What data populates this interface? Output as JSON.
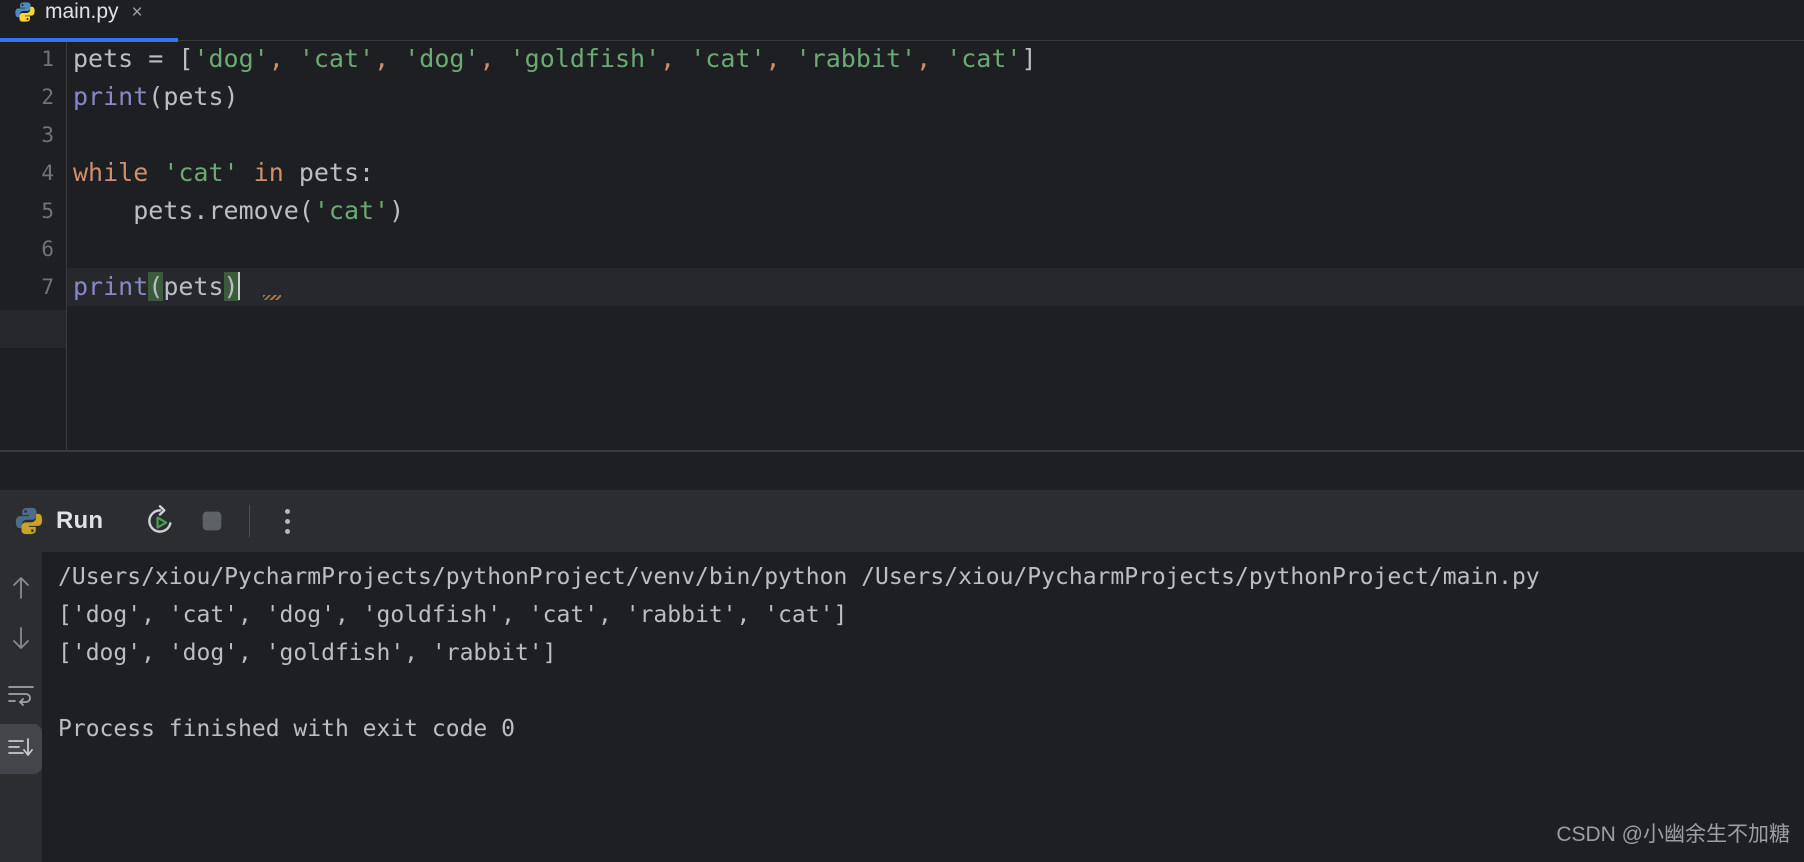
{
  "window": {
    "theme": "dark",
    "colors": {
      "editor_bg": "#1E1F22",
      "panel_bg": "#2B2D30",
      "tab_accent": "#3574F0",
      "keyword": "#CF8E6D",
      "string": "#6AAB73",
      "function": "#8888C6",
      "text": "#BCBEC4",
      "line_number": "#6F737A",
      "bracket_highlight": "#3A5C3D",
      "caret_row": "#26282E"
    }
  },
  "tabbar": {
    "tabs": [
      {
        "label": "main.py",
        "icon": "python-file-icon",
        "close_glyph": "×",
        "active": true
      }
    ]
  },
  "editor": {
    "line_numbers": [
      "1",
      "2",
      "3",
      "4",
      "5",
      "6",
      "7"
    ],
    "caret_line_index": 7,
    "lines": [
      {
        "number": "1",
        "plain": "pets = ['dog', 'cat', 'dog', 'goldfish', 'cat', 'rabbit', 'cat']",
        "tokens": [
          {
            "t": "pets ",
            "c": "ident"
          },
          {
            "t": "= ",
            "c": "punct"
          },
          {
            "t": "[",
            "c": "punct"
          },
          {
            "t": "'dog'",
            "c": "str"
          },
          {
            "t": ",",
            "c": "comma"
          },
          {
            "t": " ",
            "c": "punct"
          },
          {
            "t": "'cat'",
            "c": "str"
          },
          {
            "t": ",",
            "c": "comma"
          },
          {
            "t": " ",
            "c": "punct"
          },
          {
            "t": "'dog'",
            "c": "str"
          },
          {
            "t": ",",
            "c": "comma"
          },
          {
            "t": " ",
            "c": "punct"
          },
          {
            "t": "'goldfish'",
            "c": "str"
          },
          {
            "t": ",",
            "c": "comma"
          },
          {
            "t": " ",
            "c": "punct"
          },
          {
            "t": "'cat'",
            "c": "str"
          },
          {
            "t": ",",
            "c": "comma"
          },
          {
            "t": " ",
            "c": "punct"
          },
          {
            "t": "'rabbit'",
            "c": "str"
          },
          {
            "t": ",",
            "c": "comma"
          },
          {
            "t": " ",
            "c": "punct"
          },
          {
            "t": "'cat'",
            "c": "str"
          },
          {
            "t": "]",
            "c": "punct"
          }
        ]
      },
      {
        "number": "2",
        "plain": "print(pets)",
        "tokens": [
          {
            "t": "print",
            "c": "fn"
          },
          {
            "t": "(",
            "c": "punct"
          },
          {
            "t": "pets",
            "c": "ident"
          },
          {
            "t": ")",
            "c": "punct"
          }
        ]
      },
      {
        "number": "3",
        "plain": "",
        "tokens": []
      },
      {
        "number": "4",
        "plain": "while 'cat' in pets:",
        "tokens": [
          {
            "t": "while",
            "c": "kw"
          },
          {
            "t": " ",
            "c": "punct"
          },
          {
            "t": "'cat'",
            "c": "str"
          },
          {
            "t": " ",
            "c": "punct"
          },
          {
            "t": "in",
            "c": "kw"
          },
          {
            "t": " ",
            "c": "punct"
          },
          {
            "t": "pets",
            "c": "ident"
          },
          {
            "t": ":",
            "c": "punct"
          }
        ]
      },
      {
        "number": "5",
        "plain": "    pets.remove('cat')",
        "tokens": [
          {
            "t": "    pets.remove",
            "c": "ident"
          },
          {
            "t": "(",
            "c": "punct"
          },
          {
            "t": "'cat'",
            "c": "str"
          },
          {
            "t": ")",
            "c": "punct"
          }
        ]
      },
      {
        "number": "6",
        "plain": "",
        "tokens": []
      },
      {
        "number": "7",
        "plain": "print(pets)",
        "tokens": [
          {
            "t": "print",
            "c": "fn"
          },
          {
            "t": "(",
            "c": "brkhl"
          },
          {
            "t": "pets",
            "c": "ident"
          },
          {
            "t": ")",
            "c": "brkhl"
          }
        ]
      }
    ]
  },
  "run_panel": {
    "title": "Run",
    "icons": {
      "app": "python-icon",
      "rerun": "rerun-icon",
      "stop": "stop-icon",
      "more": "more-options-icon"
    },
    "gutter_icons": [
      {
        "name": "scroll-up-icon",
        "glyph": "↑"
      },
      {
        "name": "scroll-down-icon",
        "glyph": "↓"
      },
      {
        "name": "soft-wrap-icon",
        "glyph": "↩"
      },
      {
        "name": "scroll-to-end-icon",
        "glyph": "↓",
        "active": true
      }
    ],
    "console_lines": [
      "/Users/xiou/PycharmProjects/pythonProject/venv/bin/python /Users/xiou/PycharmProjects/pythonProject/main.py",
      "['dog', 'cat', 'dog', 'goldfish', 'cat', 'rabbit', 'cat']",
      "['dog', 'dog', 'goldfish', 'rabbit']",
      "",
      "Process finished with exit code 0"
    ]
  },
  "watermark": {
    "text": "CSDN @小幽余生不加糖"
  }
}
